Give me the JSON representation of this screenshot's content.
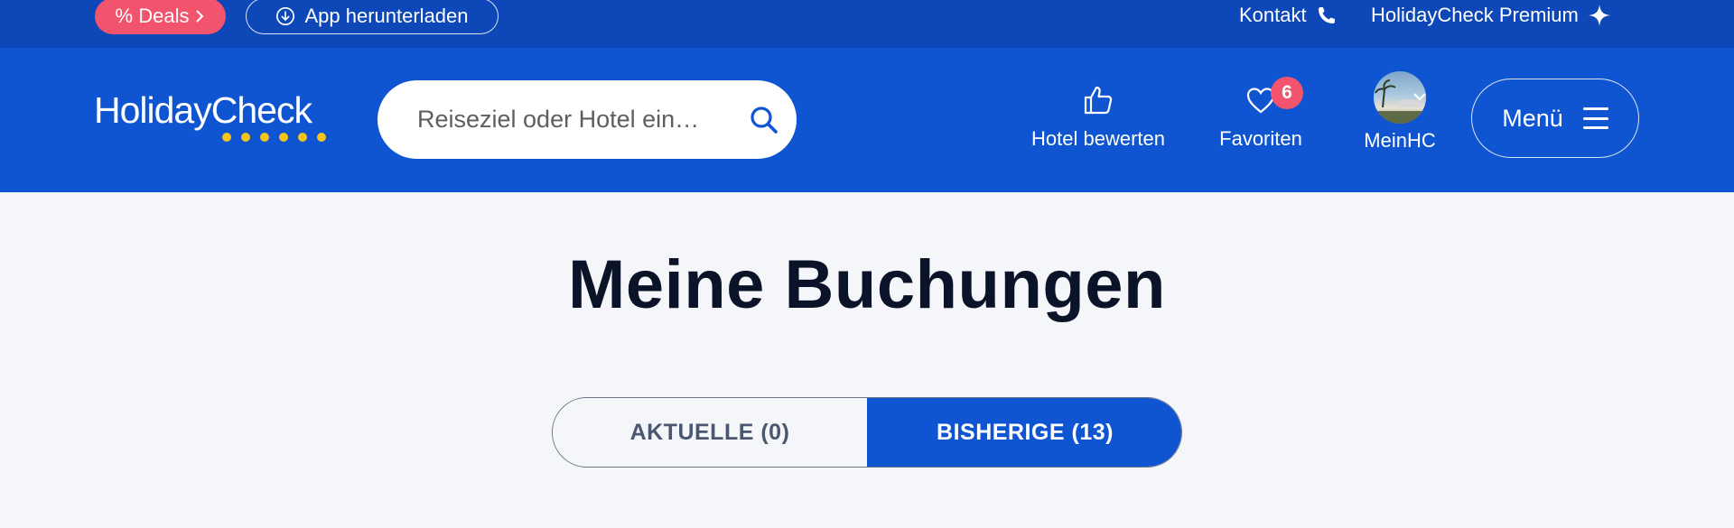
{
  "topbar": {
    "deals_label": "% Deals",
    "app_label": "App herunterladen",
    "kontakt_label": "Kontakt",
    "premium_label": "HolidayCheck Premium"
  },
  "header": {
    "logo_text": "HolidayCheck",
    "search": {
      "placeholder": "Reiseziel oder Hotel ein…",
      "icon": "search-icon"
    },
    "rate_label": "Hotel bewerten",
    "favorites_label": "Favoriten",
    "favorites_count": "6",
    "mein_label": "MeinHC",
    "menu_label": "Menü"
  },
  "main": {
    "title": "Meine Buchungen",
    "tabs": [
      {
        "label": "AKTUELLE (0)",
        "active": false
      },
      {
        "label": "BISHERIGE (13)",
        "active": true
      }
    ]
  },
  "colors": {
    "topbar": "#0d47b8",
    "header": "#0f55d2",
    "deals": "#f2546e",
    "logo_dots": "#f6c31b",
    "page_bg": "#f5f6fa"
  }
}
